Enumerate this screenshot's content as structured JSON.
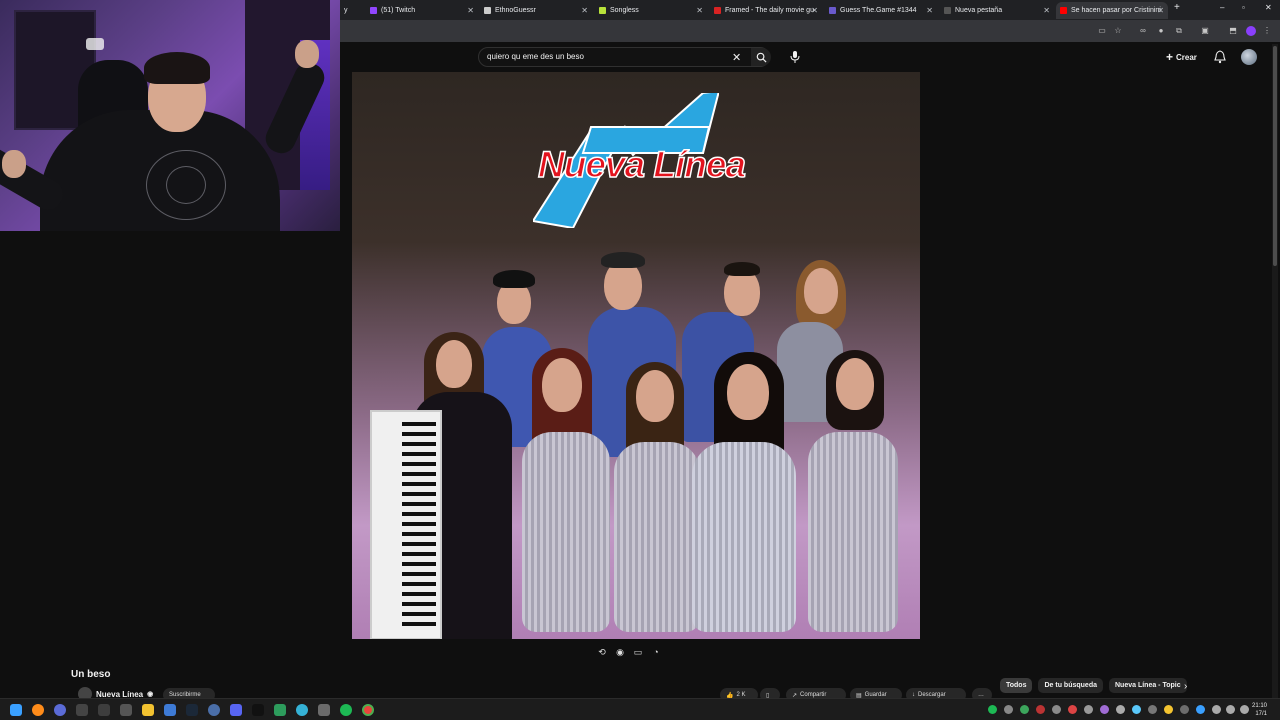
{
  "browser": {
    "tabs": [
      {
        "label": "y",
        "color": "#ff0000"
      },
      {
        "label": "(51) Twitch",
        "color": "#9146ff"
      },
      {
        "label": "EthnoGuessr",
        "color": "#cccccc"
      },
      {
        "label": "Songless",
        "color": "#b8e23a"
      },
      {
        "label": "Framed - The daily movie gu",
        "color": "#d92323"
      },
      {
        "label": "Guess The.Game #1344",
        "color": "#6a5acd"
      },
      {
        "label": "Nueva pestaña",
        "color": "#555555"
      },
      {
        "label": "Se hacen pasar por Cristinini",
        "color": "#ff0000"
      }
    ],
    "new_tab": "+",
    "window_controls": [
      "–",
      "▫",
      "✕"
    ]
  },
  "youtube": {
    "search": {
      "query": "quiero qu eme des un beso"
    },
    "create_label": "Crear"
  },
  "video": {
    "title": "Un beso",
    "channel": "Nueva Línea",
    "subscribe_text": "Suscribirme",
    "actions": [
      {
        "name": "like-button",
        "label": "2 K"
      },
      {
        "name": "share-button",
        "label": "Compartir"
      },
      {
        "name": "save-button",
        "label": "Guardar"
      },
      {
        "name": "download-button",
        "label": "Descargar"
      }
    ],
    "thumbnail_logo": "Nueva Línea"
  },
  "chips": [
    {
      "label": "Todos",
      "active": true
    },
    {
      "label": "De tu búsqueda",
      "active": false
    },
    {
      "label": "Nueva Línea - Topic",
      "active": false
    }
  ],
  "clock": {
    "time": "21:10",
    "date": "17/1"
  }
}
